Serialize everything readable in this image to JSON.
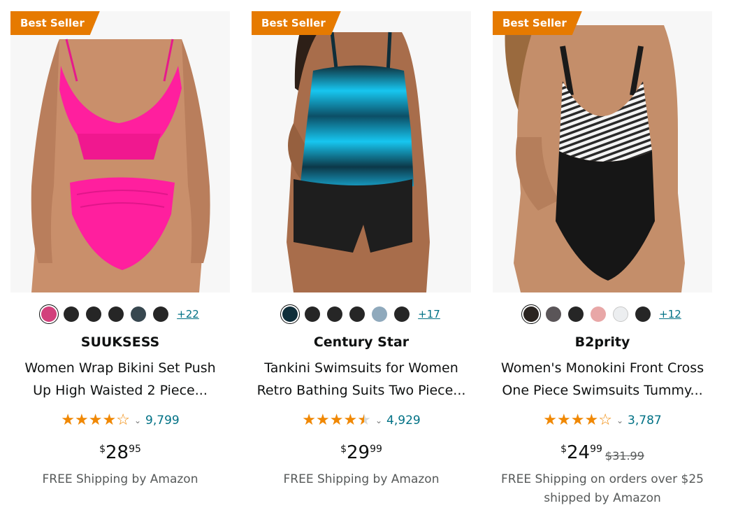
{
  "products": [
    {
      "badge": "Best Seller",
      "brand": "SUUKSESS",
      "title_line1": "Women Wrap Bikini Set Push",
      "title_line2": "Up High Waisted 2 Piece...",
      "rating": 4.0,
      "rating_count": "9,799",
      "price_currency": "$",
      "price_whole": "28",
      "price_fraction": "95",
      "was_price": "",
      "shipping_line1": "FREE Shipping by Amazon",
      "shipping_line2": "",
      "more_colors": "+22",
      "swatch_colors": [
        "#d2417c",
        "#262626",
        "#262626",
        "#262626",
        "#37474f",
        "#262626"
      ]
    },
    {
      "badge": "Best Seller",
      "brand": "Century Star",
      "title_line1": "Tankini Swimsuits for Women",
      "title_line2": "Retro Bathing Suits Two Piece...",
      "rating": 4.5,
      "rating_count": "4,929",
      "price_currency": "$",
      "price_whole": "29",
      "price_fraction": "99",
      "was_price": "",
      "shipping_line1": "FREE Shipping by Amazon",
      "shipping_line2": "",
      "more_colors": "+17",
      "swatch_colors": [
        "#0f2e3a",
        "#262626",
        "#262626",
        "#262626",
        "#8fa9bc",
        "#262626"
      ]
    },
    {
      "badge": "Best Seller",
      "brand": "B2prity",
      "title_line1": "Women's Monokini Front Cross",
      "title_line2": "One Piece Swimsuits Tummy...",
      "rating": 4.0,
      "rating_count": "3,787",
      "price_currency": "$",
      "price_whole": "24",
      "price_fraction": "99",
      "was_price": "$31.99",
      "shipping_line1": "FREE Shipping on orders over $25",
      "shipping_line2": "shipped by Amazon",
      "more_colors": "+12",
      "swatch_colors": [
        "#2a2420",
        "#5a5558",
        "#262626",
        "#e8a7a7",
        "#eceef0",
        "#262626"
      ]
    }
  ],
  "colors": {
    "badge": "#e67a00",
    "star": "#f08804",
    "link": "#007185",
    "muted": "#565959"
  }
}
